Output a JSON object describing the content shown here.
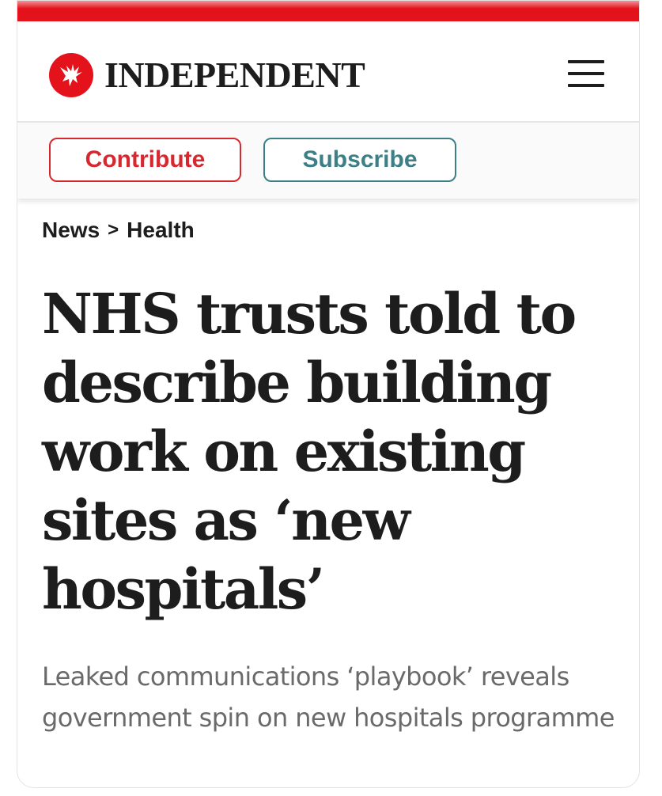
{
  "brand": {
    "name": "INDEPENDENT",
    "accent_color": "#e4121b",
    "logo_icon": "eagle-icon"
  },
  "header": {
    "menu_icon": "hamburger-menu-icon"
  },
  "actions": {
    "contribute_label": "Contribute",
    "subscribe_label": "Subscribe",
    "contribute_color": "#d7282f",
    "subscribe_color": "#3c7f86"
  },
  "breadcrumb": {
    "items": [
      "News",
      "Health"
    ],
    "separator": ">"
  },
  "article": {
    "headline": "NHS trusts told to describe building work on existing sites as ‘new hospitals’",
    "standfirst": "Leaked communications ‘playbook’ reveals government spin on new hospitals programme"
  }
}
